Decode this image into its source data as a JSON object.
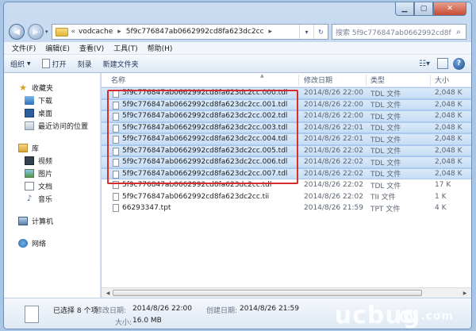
{
  "address": {
    "overflow_chevron": "«",
    "segments": [
      "vodcache",
      "5f9c776847ab0662992cd8fa623dc2cc"
    ],
    "separator": "▸",
    "search_placeholder": "搜索 5f9c776847ab0662992cd8fa6..."
  },
  "menu": [
    "文件(F)",
    "编辑(E)",
    "查看(V)",
    "工具(T)",
    "帮助(H)"
  ],
  "toolbar": {
    "organize": "组织",
    "open": "打开",
    "burn": "刻录",
    "new_folder": "新建文件夹"
  },
  "nav": {
    "favorites": "收藏夹",
    "favorites_items": [
      "下载",
      "桌面",
      "最近访问的位置"
    ],
    "libraries": "库",
    "library_items": [
      "视频",
      "图片",
      "文档",
      "音乐"
    ],
    "computer": "计算机",
    "network": "网络"
  },
  "columns": {
    "name": "名称",
    "date": "修改日期",
    "type": "类型",
    "size": "大小"
  },
  "files": [
    {
      "name": "5f9c776847ab0662992cd8fa623dc2cc.000.tdl",
      "date": "2014/8/26 22:00",
      "type": "TDL 文件",
      "size": "2,048 K",
      "selected": true
    },
    {
      "name": "5f9c776847ab0662992cd8fa623dc2cc.001.tdl",
      "date": "2014/8/26 22:00",
      "type": "TDL 文件",
      "size": "2,048 K",
      "selected": true
    },
    {
      "name": "5f9c776847ab0662992cd8fa623dc2cc.002.tdl",
      "date": "2014/8/26 22:00",
      "type": "TDL 文件",
      "size": "2,048 K",
      "selected": true
    },
    {
      "name": "5f9c776847ab0662992cd8fa623dc2cc.003.tdl",
      "date": "2014/8/26 22:01",
      "type": "TDL 文件",
      "size": "2,048 K",
      "selected": true
    },
    {
      "name": "5f9c776847ab0662992cd8fa623dc2cc.004.tdl",
      "date": "2014/8/26 22:01",
      "type": "TDL 文件",
      "size": "2,048 K",
      "selected": true
    },
    {
      "name": "5f9c776847ab0662992cd8fa623dc2cc.005.tdl",
      "date": "2014/8/26 22:02",
      "type": "TDL 文件",
      "size": "2,048 K",
      "selected": true
    },
    {
      "name": "5f9c776847ab0662992cd8fa623dc2cc.006.tdl",
      "date": "2014/8/26 22:02",
      "type": "TDL 文件",
      "size": "2,048 K",
      "selected": true
    },
    {
      "name": "5f9c776847ab0662992cd8fa623dc2cc.007.tdl",
      "date": "2014/8/26 22:02",
      "type": "TDL 文件",
      "size": "2,048 K",
      "selected": true
    },
    {
      "name": "5f9c776847ab0662992cd8fa623dc2cc.tdl",
      "date": "2014/8/26 22:02",
      "type": "TDL 文件",
      "size": "17 K",
      "selected": false
    },
    {
      "name": "5f9c776847ab0662992cd8fa623dc2cc.tii",
      "date": "2014/8/26 22:02",
      "type": "TII 文件",
      "size": "1 K",
      "selected": false
    },
    {
      "name": "66293347.tpt",
      "date": "2014/8/26 21:59",
      "type": "TPT 文件",
      "size": "4 K",
      "selected": false
    }
  ],
  "details": {
    "title": "已选择 8 个项",
    "modified_label": "修改日期:",
    "modified_value": "2014/8/26 22:00",
    "created_label": "创建日期:",
    "created_value": "2014/8/26 21:59",
    "size_label": "大小:",
    "size_value": "16.0 MB"
  },
  "watermark": "ucbug",
  "watermark_suffix": ".com",
  "colors": {
    "selection": "#c6ddf5",
    "highlight_border": "#d42d2d",
    "chrome": "#b7cfe8"
  }
}
